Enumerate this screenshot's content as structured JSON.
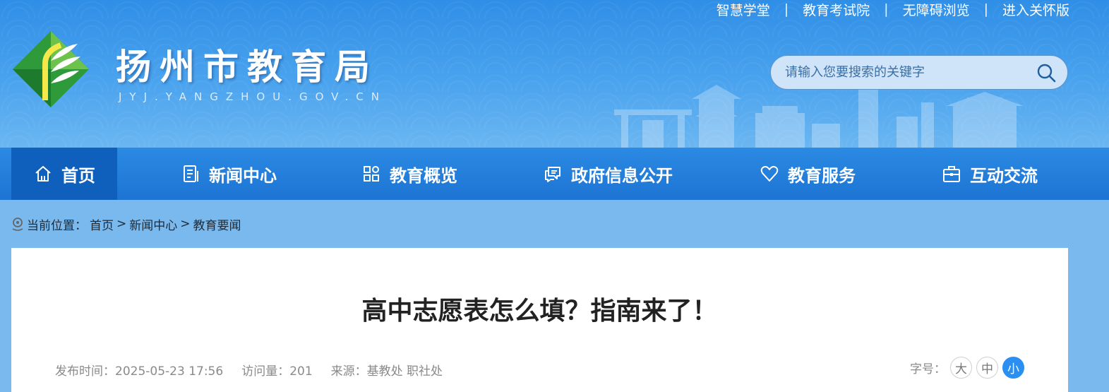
{
  "top_links": [
    "智慧学堂",
    "教育考试院",
    "无障碍浏览",
    "进入关怀版"
  ],
  "top_link_separator": "|",
  "site": {
    "title": "扬州市教育局",
    "domain": "JYJ.YANGZHOU.GOV.CN"
  },
  "search": {
    "placeholder": "请输入您要搜索的关键字",
    "icon": "search-icon"
  },
  "nav": [
    {
      "label": "首页",
      "icon": "home-icon",
      "active": true
    },
    {
      "label": "新闻中心",
      "icon": "document-icon"
    },
    {
      "label": "教育概览",
      "icon": "grid-icon"
    },
    {
      "label": "政府信息公开",
      "icon": "chat-icon"
    },
    {
      "label": "教育服务",
      "icon": "heart-icon"
    },
    {
      "label": "互动交流",
      "icon": "briefcase-icon"
    }
  ],
  "breadcrumb": {
    "prefix": "当前位置：",
    "items": [
      "首页",
      "新闻中心",
      "教育要闻"
    ],
    "separator": ">"
  },
  "article": {
    "title": "高中志愿表怎么填？指南来了！",
    "publish_time": "发布时间：2025-05-23 17:56",
    "views": "访问量：201",
    "source": "来源：基教处 职社处",
    "font_size_label": "字号：",
    "font_sizes": [
      "大",
      "中",
      "小"
    ],
    "font_size_selected": "小"
  },
  "colors": {
    "header": "#2f8ee6",
    "nav": "#1d74d3",
    "nav_active": "#0f5fbd",
    "page_bg": "#7ab9ee",
    "accent": "#2a8ff0"
  }
}
